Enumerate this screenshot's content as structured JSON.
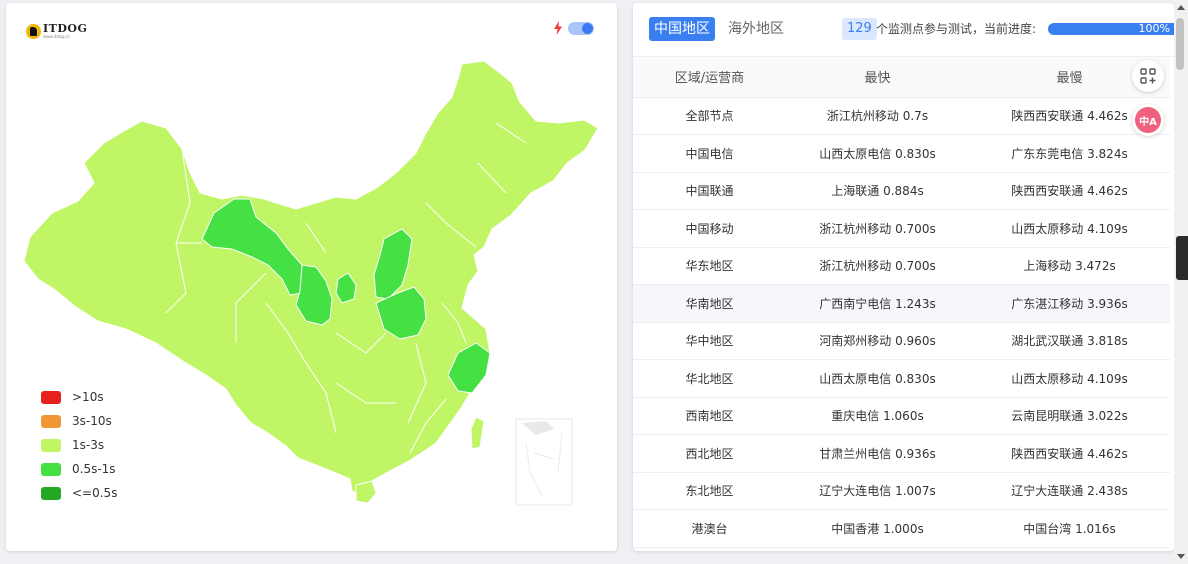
{
  "logo": {
    "text": "ITDOG",
    "subtext": "www.itdog.cn"
  },
  "map": {
    "icons": {
      "toggle": "lightning-icon"
    },
    "colors": {
      "base": "#c0f565",
      "highlight": "#45e144",
      "border": "#ffffff"
    },
    "legend": [
      {
        "label": ">10s",
        "color": "#e8211f"
      },
      {
        "label": "3s-10s",
        "color": "#f39736"
      },
      {
        "label": "1s-3s",
        "color": "#c0f565"
      },
      {
        "label": "0.5s-1s",
        "color": "#45e144"
      },
      {
        "label": "<=0.5s",
        "color": "#24a724"
      }
    ]
  },
  "panel": {
    "tabs": [
      "中国地区",
      "海外地区"
    ],
    "active_tab": "中国地区",
    "monitor_count": "129",
    "status_text": "个监测点参与测试，当前进度:",
    "progress_label": "100%",
    "progress": 1.0,
    "columns": [
      "区域/运营商",
      "最快",
      "最慢"
    ],
    "rows": [
      [
        "全部节点",
        "浙江杭州移动 0.7s",
        "陕西西安联通 4.462s"
      ],
      [
        "中国电信",
        "山西太原电信 0.830s",
        "广东东莞电信 3.824s"
      ],
      [
        "中国联通",
        "上海联通 0.884s",
        "陕西西安联通 4.462s"
      ],
      [
        "中国移动",
        "浙江杭州移动 0.700s",
        "山西太原移动 4.109s"
      ],
      [
        "华东地区",
        "浙江杭州移动 0.700s",
        "上海移动 3.472s"
      ],
      [
        "华南地区",
        "广西南宁电信 1.243s",
        "广东湛江移动 3.936s"
      ],
      [
        "华中地区",
        "河南郑州移动 0.960s",
        "湖北武汉联通 3.818s"
      ],
      [
        "华北地区",
        "山西太原电信 0.830s",
        "山西太原移动 4.109s"
      ],
      [
        "西南地区",
        "重庆电信 1.060s",
        "云南昆明联通 3.022s"
      ],
      [
        "西北地区",
        "甘肃兰州电信 0.936s",
        "陕西西安联通 4.462s"
      ],
      [
        "东北地区",
        "辽宁大连电信 1.007s",
        "辽宁大连联通 2.438s"
      ],
      [
        "港澳台",
        "中国香港 1.000s",
        "中国台湾 1.016s"
      ]
    ]
  },
  "floating": {
    "grid_icon": "apps-add-icon",
    "translate_label": "中A"
  }
}
